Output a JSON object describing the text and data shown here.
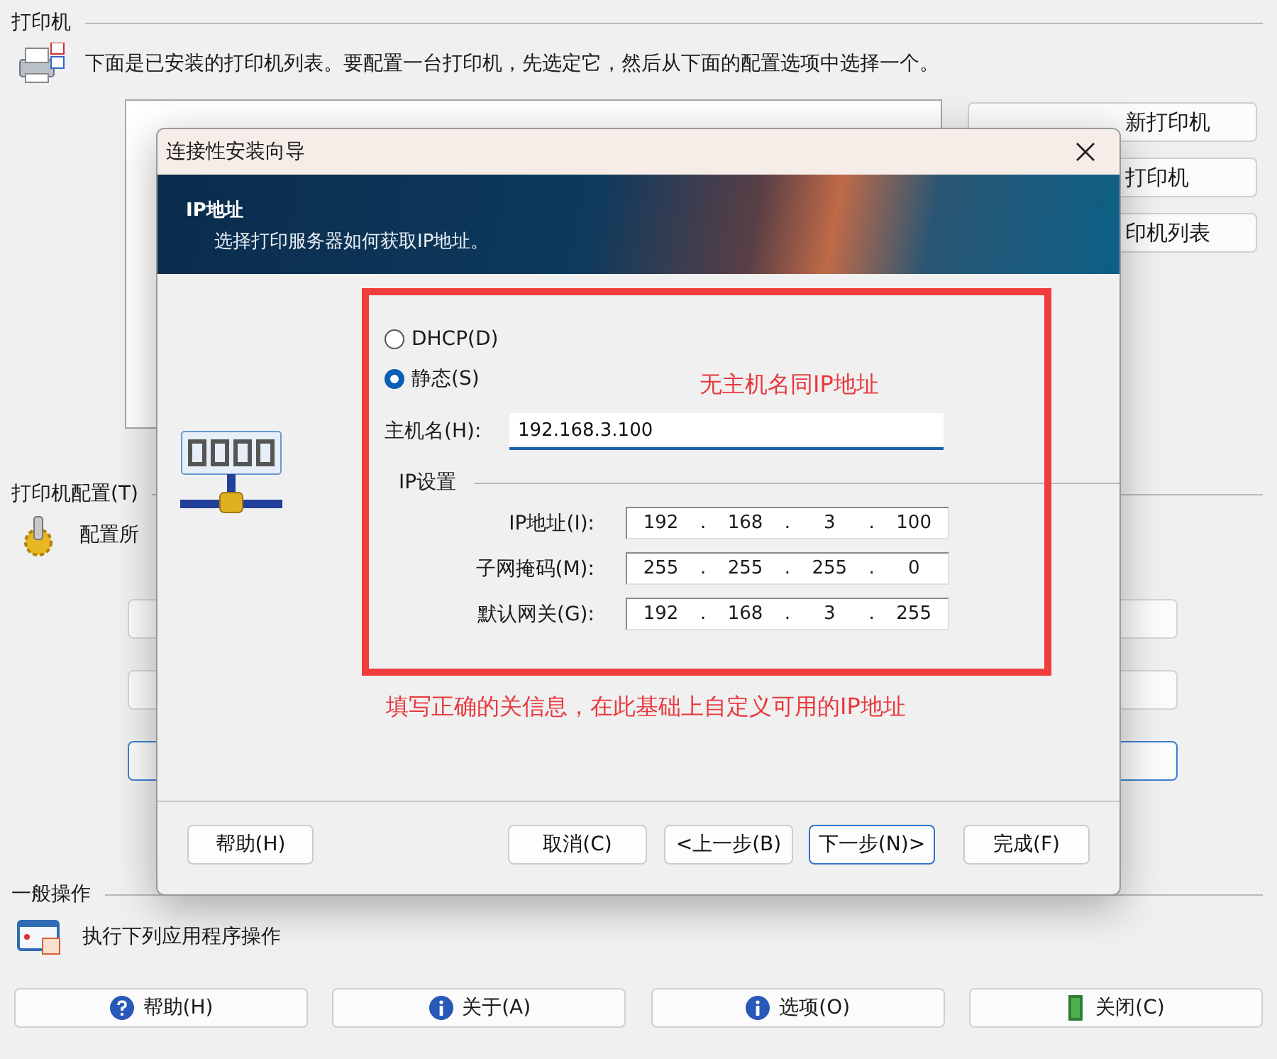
{
  "printers_section": {
    "title": "打印机",
    "description": "下面是已安装的打印机列表。要配置一台打印机，先选定它，然后从下面的配置选项中选择一个。",
    "side_buttons": [
      "新打印机",
      "打印机",
      "印机列表"
    ]
  },
  "config_section": {
    "title": "打印机配置(T)",
    "description": "配置所",
    "option_buttons": [
      {
        "focused": false
      },
      {
        "focused": false
      },
      {
        "focused": true
      }
    ]
  },
  "general_section": {
    "title": "一般操作",
    "description": "执行下列应用程序操作",
    "buttons": [
      {
        "label": "帮助(H)",
        "kind": "help"
      },
      {
        "label": "关于(A)",
        "kind": "info"
      },
      {
        "label": "选项(O)",
        "kind": "info"
      },
      {
        "label": "关闭(C)",
        "kind": "exit"
      }
    ]
  },
  "dialog": {
    "title": "连接性安装向导",
    "header": {
      "title": "IP地址",
      "subtitle": "选择打印服务器如何获取IP地址。"
    },
    "address_mode": [
      {
        "label": "DHCP(D)",
        "selected": false
      },
      {
        "label": "静态(S)",
        "selected": true
      }
    ],
    "hostname": {
      "label": "主机名(H):",
      "value": "192.168.3.100"
    },
    "ip_settings": {
      "title": "IP设置",
      "separator": ".",
      "fields": [
        {
          "label": "IP地址(I):",
          "octets": [
            "192",
            "168",
            "3",
            "100"
          ]
        },
        {
          "label": "子网掩码(M):",
          "octets": [
            "255",
            "255",
            "255",
            "0"
          ]
        },
        {
          "label": "默认网关(G):",
          "octets": [
            "192",
            "168",
            "3",
            "255"
          ]
        }
      ]
    },
    "buttons": [
      {
        "label": "帮助(H)",
        "focused": false
      },
      {
        "label": "取消(C)",
        "focused": false
      },
      {
        "label": "<上一步(B)",
        "focused": false
      },
      {
        "label": "下一步(N)>",
        "focused": true
      },
      {
        "label": "完成(F)",
        "focused": false
      }
    ]
  },
  "annotations": {
    "box_note": "无主机名同IP地址",
    "bottom_note": "填写正确的关信息，在此基础上自定义可用的IP地址"
  }
}
